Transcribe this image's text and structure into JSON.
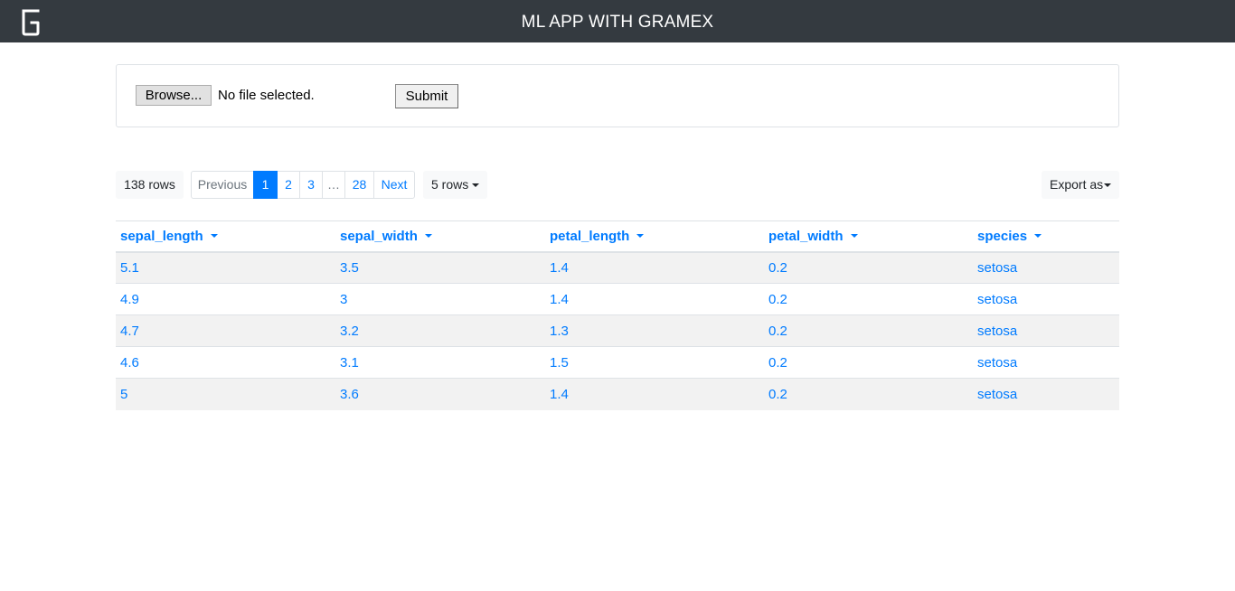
{
  "navbar": {
    "title": "ML APP WITH GRAMEX",
    "logo_icon": "gramex-logo-icon",
    "background": "#343a40"
  },
  "upload": {
    "browse_label": "Browse...",
    "file_status": "No file selected.",
    "submit_label": "Submit"
  },
  "table_controls": {
    "row_count": "138 rows",
    "pagination": {
      "previous": "Previous",
      "pages": [
        "1",
        "2",
        "3",
        "…",
        "28"
      ],
      "next": "Next",
      "current": "1"
    },
    "page_size": "5 rows",
    "export": "Export as"
  },
  "table": {
    "columns": [
      "sepal_length",
      "sepal_width",
      "petal_length",
      "petal_width",
      "species"
    ],
    "rows": [
      [
        "5.1",
        "3.5",
        "1.4",
        "0.2",
        "setosa"
      ],
      [
        "4.9",
        "3",
        "1.4",
        "0.2",
        "setosa"
      ],
      [
        "4.7",
        "3.2",
        "1.3",
        "0.2",
        "setosa"
      ],
      [
        "4.6",
        "3.1",
        "1.5",
        "0.2",
        "setosa"
      ],
      [
        "5",
        "3.6",
        "1.4",
        "0.2",
        "setosa"
      ]
    ]
  },
  "colors": {
    "link": "#007bff",
    "stripe": "#f2f2f2",
    "border": "#dee2e6"
  }
}
